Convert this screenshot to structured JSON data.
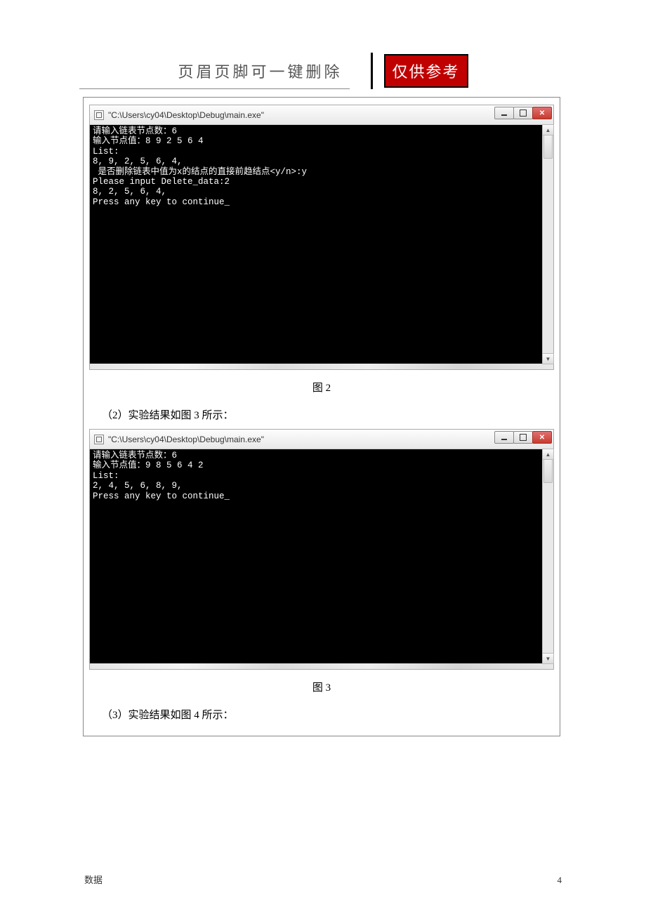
{
  "header": {
    "text": "页眉页脚可一键删除",
    "stamp": "仅供参考"
  },
  "consoles": [
    {
      "title": "\"C:\\Users\\cy04\\Desktop\\Debug\\main.exe\"",
      "lines": "请输入链表节点数：6\n输入节点值：8 9 2 5 6 4\nList:\n8, 9, 2, 5, 6, 4,\n 是否删除链表中值为x的结点的直接前趋结点<y/n>:y\nPlease input Delete_data:2\n8, 2, 5, 6, 4,\nPress any key to continue_",
      "caption": "图 2"
    },
    {
      "title": "\"C:\\Users\\cy04\\Desktop\\Debug\\main.exe\"",
      "lines": "请输入链表节点数：6\n输入节点值：9 8 5 6 4 2\nList:\n2, 4, 5, 6, 8, 9,\nPress any key to continue_",
      "caption": "图 3"
    }
  ],
  "paragraphs": {
    "p1": "（2）实验结果如图 3 所示：",
    "p2": "（3）实验结果如图 4 所示："
  },
  "footer": {
    "left": "数据",
    "right": "4"
  }
}
